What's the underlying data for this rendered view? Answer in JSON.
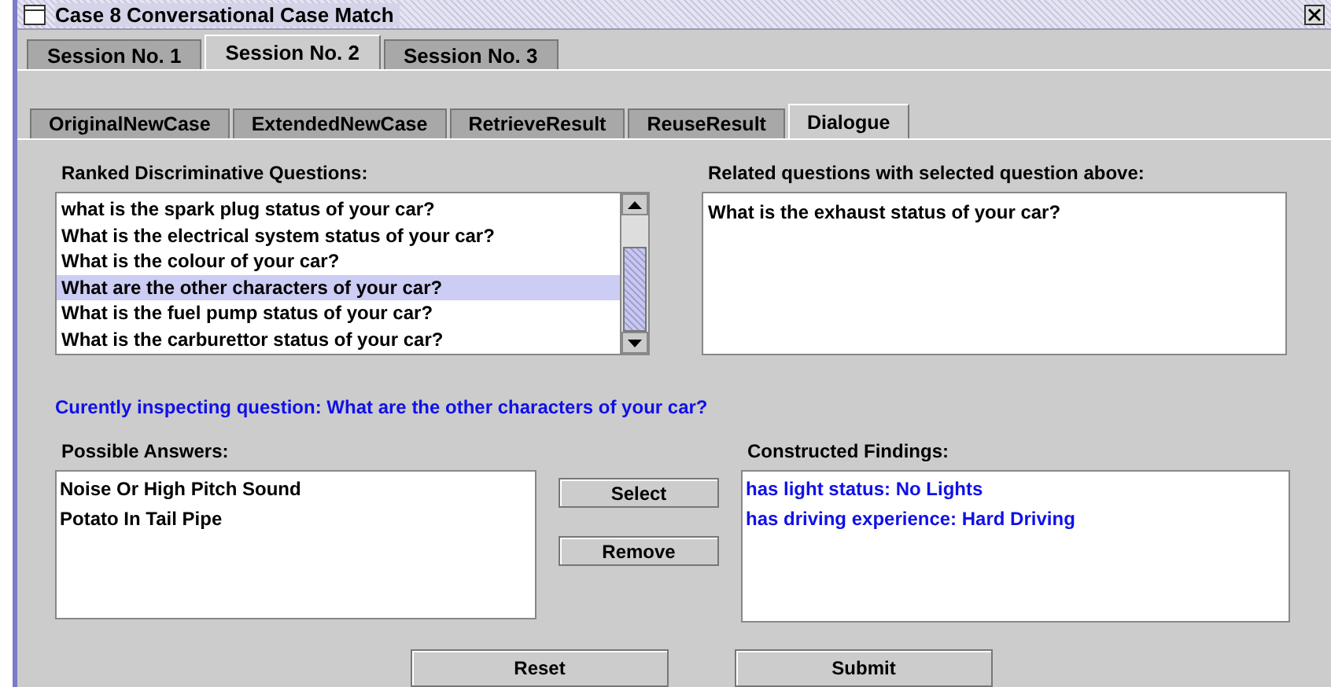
{
  "window": {
    "title": "Case 8 Conversational Case Match"
  },
  "session_tabs": [
    {
      "label": "Session No. 1",
      "selected": false
    },
    {
      "label": "Session No. 2",
      "selected": true
    },
    {
      "label": "Session No. 3",
      "selected": false
    }
  ],
  "view_tabs": [
    {
      "label": "OriginalNewCase",
      "selected": false
    },
    {
      "label": "ExtendedNewCase",
      "selected": false
    },
    {
      "label": "RetrieveResult",
      "selected": false
    },
    {
      "label": "ReuseResult",
      "selected": false
    },
    {
      "label": "Dialogue",
      "selected": true
    }
  ],
  "ranked_questions": {
    "label": "Ranked Discriminative Questions:",
    "items": [
      {
        "text": "what is the spark plug status of your car?",
        "selected": false
      },
      {
        "text": "What is the electrical system status of  your car?",
        "selected": false
      },
      {
        "text": "What is the colour of your car?",
        "selected": false
      },
      {
        "text": "What are the other characters of your car?",
        "selected": true
      },
      {
        "text": "What is the fuel pump status of your car?",
        "selected": false
      },
      {
        "text": "What is the carburettor status of your car?",
        "selected": false
      }
    ]
  },
  "related_questions": {
    "label": "Related questions with selected question above:",
    "items": [
      "What is the exhaust status of your car?"
    ]
  },
  "inspecting": "Curently inspecting question: What are the other characters of your car?",
  "possible_answers": {
    "label": "Possible Answers:",
    "items": [
      "Noise Or High Pitch Sound",
      "Potato In Tail Pipe"
    ]
  },
  "side_buttons": [
    "Select",
    "Remove"
  ],
  "constructed_findings": {
    "label": "Constructed Findings:",
    "items": [
      "has light status: No Lights",
      "has driving experience: Hard Driving"
    ]
  },
  "buttons": [
    "Reset",
    "Submit"
  ]
}
